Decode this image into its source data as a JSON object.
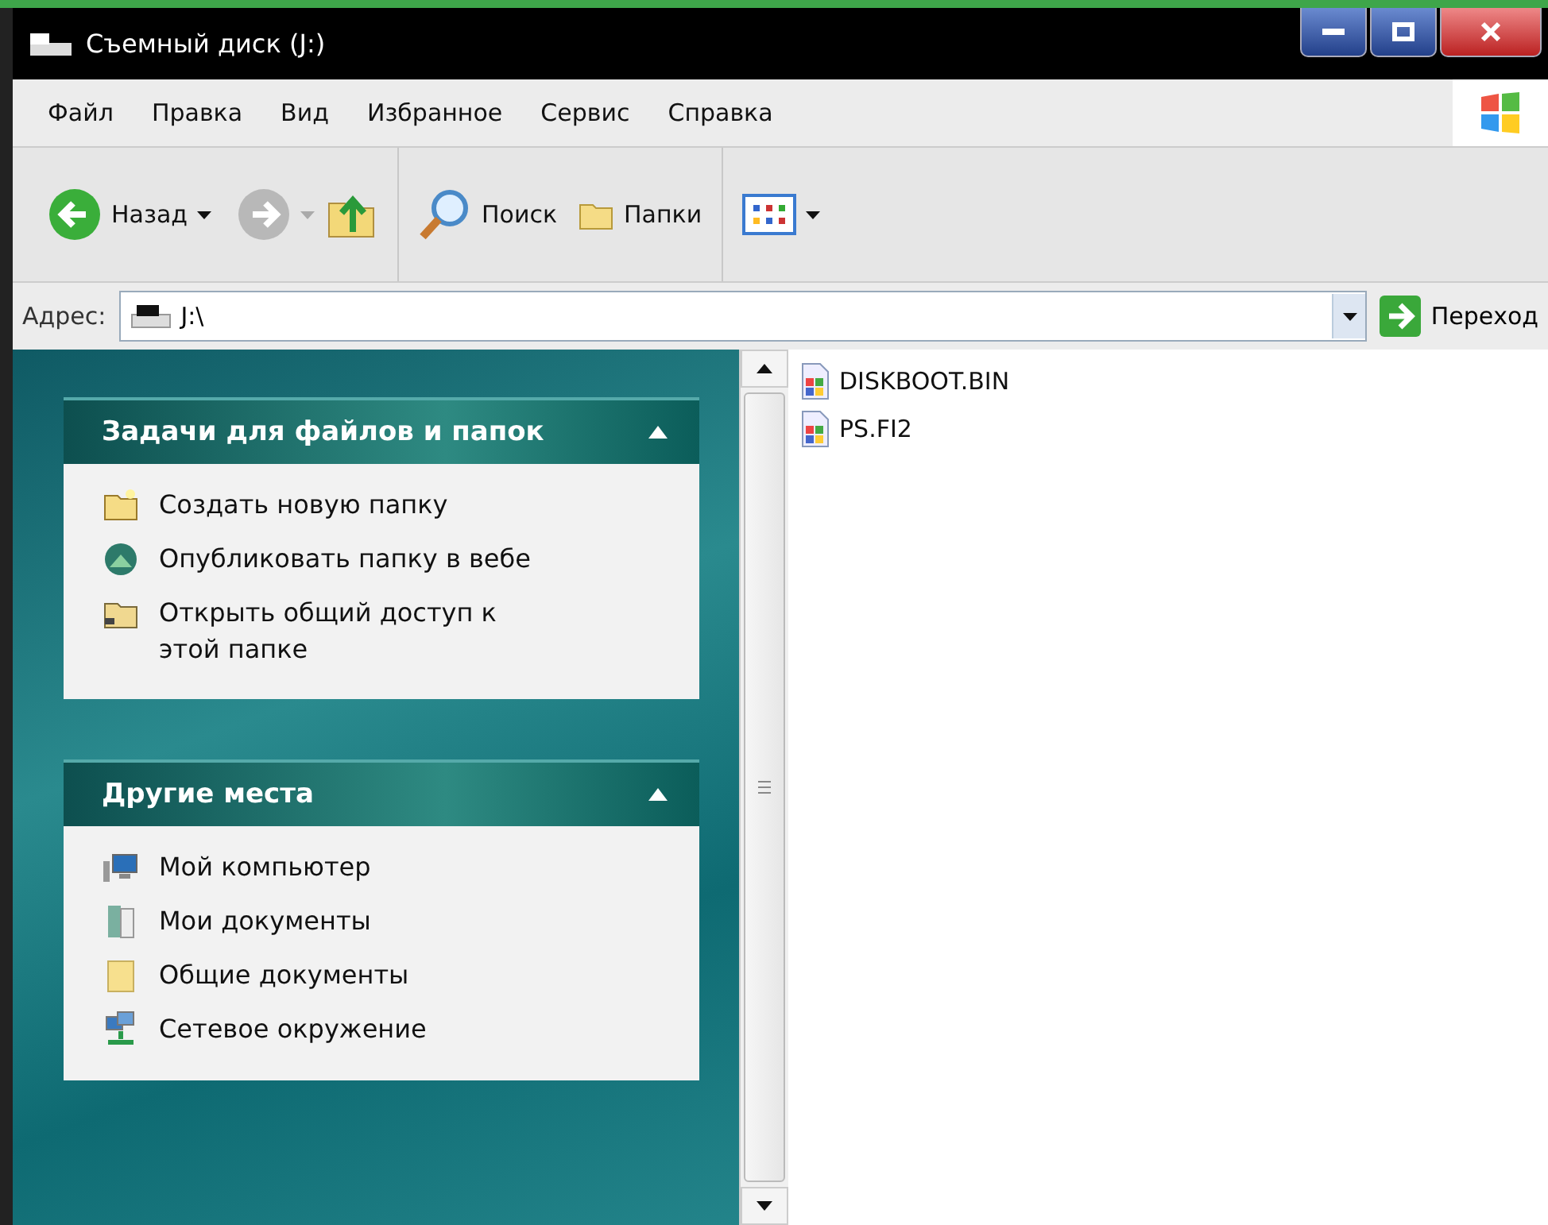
{
  "window": {
    "title": "Съемный диск (J:)"
  },
  "menu": [
    "Файл",
    "Правка",
    "Вид",
    "Избранное",
    "Сервис",
    "Справка"
  ],
  "toolbar": {
    "back": "Назад",
    "search": "Поиск",
    "folders": "Папки"
  },
  "address": {
    "label": "Адрес:",
    "value": "J:\\",
    "go": "Переход"
  },
  "sidebar": {
    "sections": [
      {
        "title": "Задачи для файлов и папок",
        "expanded": true,
        "items": [
          {
            "label": "Создать новую папку",
            "kind": "new-folder"
          },
          {
            "label": "Опубликовать папку в вебе",
            "kind": "globe"
          },
          {
            "label": "Открыть общий доступ к этой папке",
            "kind": "shared-folder"
          }
        ]
      },
      {
        "title": "Другие места",
        "expanded": true,
        "items": [
          {
            "label": "Мой компьютер",
            "kind": "computer"
          },
          {
            "label": "Мои документы",
            "kind": "documents"
          },
          {
            "label": "Общие документы",
            "kind": "folder"
          },
          {
            "label": "Сетевое окружение",
            "kind": "network"
          }
        ]
      }
    ]
  },
  "files": [
    {
      "name": "DISKBOOT.BIN"
    },
    {
      "name": "PS.FI2"
    }
  ]
}
